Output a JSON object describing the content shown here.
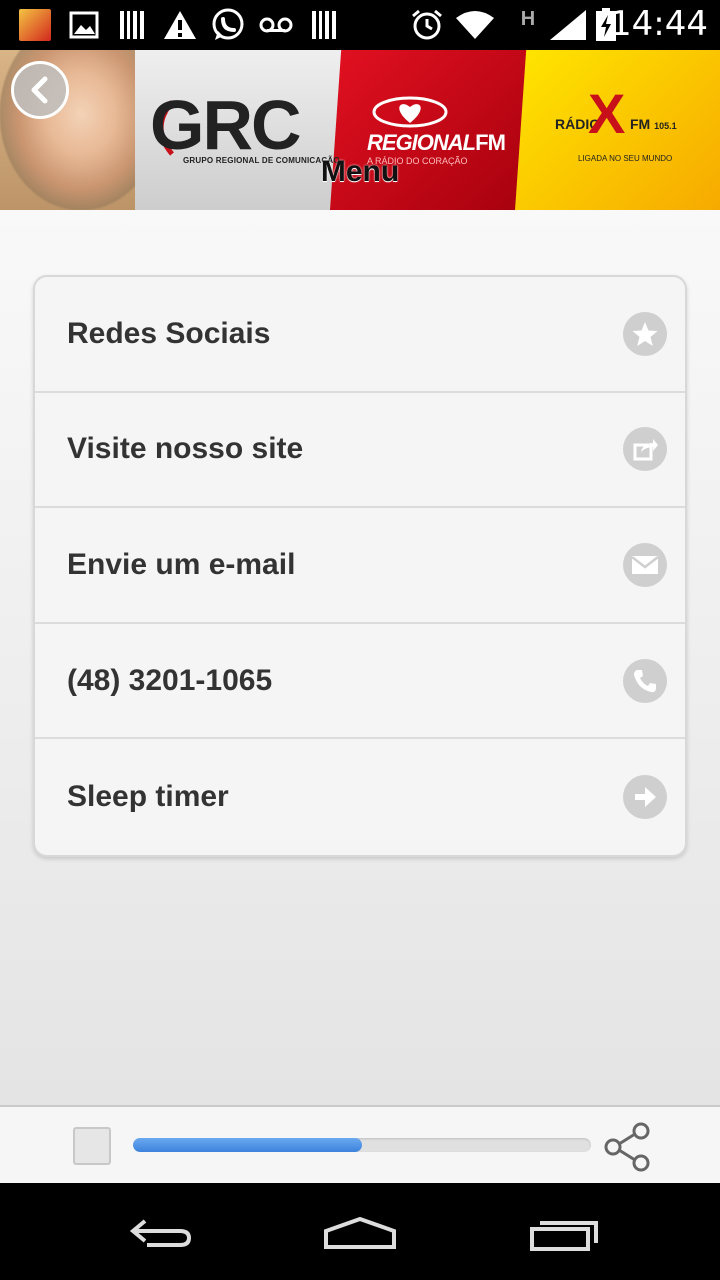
{
  "status_bar": {
    "time": "14:44",
    "icons": [
      "app-thumbnail-icon",
      "image-icon",
      "barcode-icon",
      "warning-icon",
      "whatsapp-icon",
      "voicemail-icon",
      "barcode-icon",
      "alarm-icon",
      "wifi-icon",
      "h-network-icon",
      "signal-icon",
      "battery-charging-icon"
    ],
    "network_type": "H"
  },
  "header": {
    "title": "Menu",
    "logos": {
      "grc": "GRC",
      "grc_subtitle": "GRUPO REGIONAL DE COMUNICAÇÃO",
      "regional": "REGIONAL",
      "regional_fm": "FM",
      "regional_subtitle": "A RÁDIO DO CORAÇÃO",
      "radiox_left": "RÁDIO",
      "radiox_x": "X",
      "radiox_fm": "FM",
      "radiox_freq": "105.1",
      "radiox_subtitle": "LIGADA NO SEU MUNDO"
    },
    "back_icon": "chevron-left-icon"
  },
  "menu": {
    "items": [
      {
        "label": "Redes Sociais",
        "icon": "star-icon"
      },
      {
        "label": "Visite nosso site",
        "icon": "share-external-icon"
      },
      {
        "label": "Envie um e-mail",
        "icon": "mail-icon"
      },
      {
        "label": "(48) 3201-1065",
        "icon": "phone-icon"
      },
      {
        "label": "Sleep timer",
        "icon": "arrow-right-icon"
      }
    ]
  },
  "player": {
    "stop_icon": "stop-icon",
    "progress": 0.5,
    "share_icon": "share-icon"
  },
  "nav_bar": {
    "back_icon": "back-arrow-icon",
    "home_icon": "home-icon",
    "recents_icon": "recent-apps-icon"
  },
  "colors": {
    "accent_blue": "#3d83dc",
    "brand_red": "#c8101a",
    "brand_yellow": "#ffe400"
  }
}
